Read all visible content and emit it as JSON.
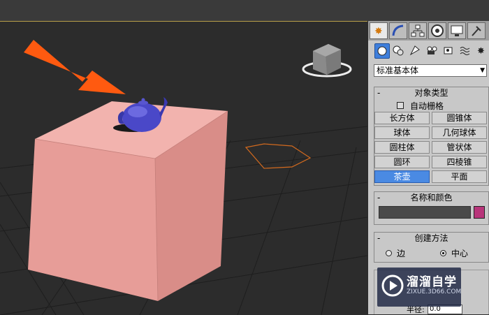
{
  "panel": {
    "dropdown": {
      "value": "标准基本体"
    },
    "object_type": {
      "title": "对象类型",
      "autogrid_label": "自动栅格",
      "buttons": [
        {
          "label": "长方体"
        },
        {
          "label": "圆锥体"
        },
        {
          "label": "球体"
        },
        {
          "label": "几何球体"
        },
        {
          "label": "圆柱体"
        },
        {
          "label": "管状体"
        },
        {
          "label": "圆环"
        },
        {
          "label": "四棱锥"
        },
        {
          "label": "茶壶",
          "active": true
        },
        {
          "label": "平面"
        }
      ]
    },
    "name_color": {
      "title": "名称和颜色",
      "color": "#b8357a"
    },
    "creation_method": {
      "title": "创建方法",
      "edge_label": "边",
      "center_label": "中心",
      "selected": "中心"
    },
    "parameters": {
      "radius_label": "半径:",
      "radius_value": "0.0"
    }
  },
  "watermark": {
    "brand": "溜溜自学",
    "url": "ZIXUE.3D66.COM"
  },
  "icons": [
    "create-tab-icon",
    "modify-tab-icon",
    "hierarchy-tab-icon",
    "motion-tab-icon",
    "display-tab-icon",
    "utilities-tab-icon",
    "geometry-icon",
    "shapes-icon",
    "lights-icon",
    "cameras-icon",
    "helpers-icon",
    "space-warps-icon",
    "systems-icon",
    "viewcube-icon",
    "arrow-icon"
  ],
  "colors": {
    "accent": "#4a8ae3",
    "box": "#e8a09b",
    "teapot": "#4040c0",
    "arrow": "#ff5a10"
  }
}
